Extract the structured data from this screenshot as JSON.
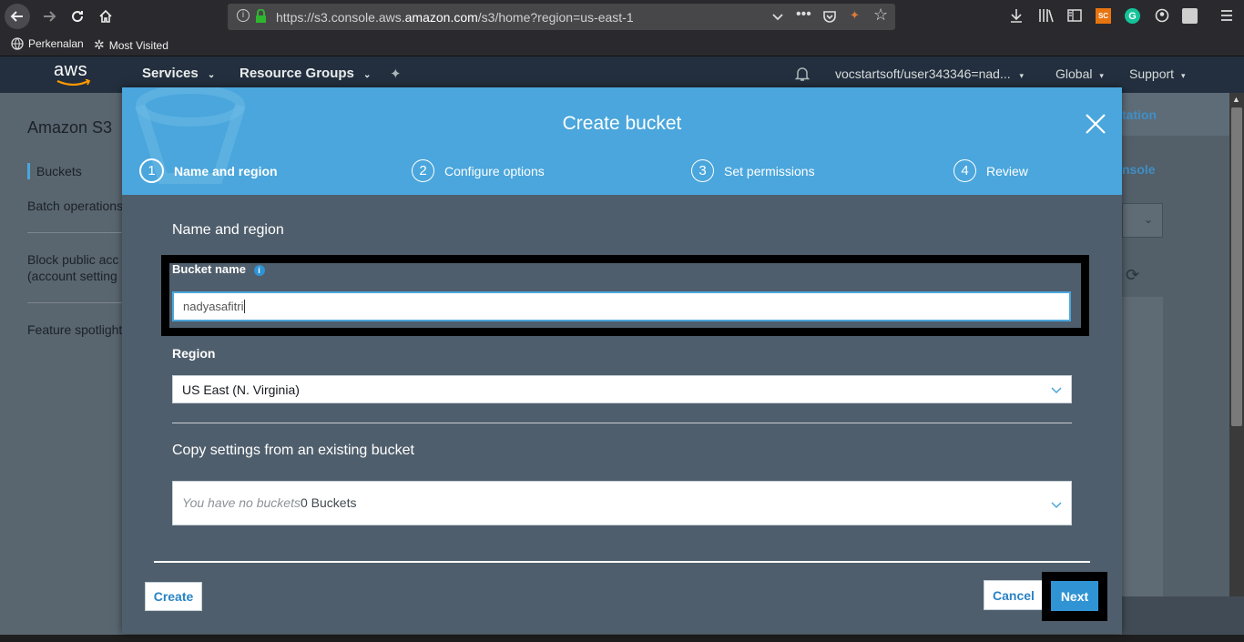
{
  "browser": {
    "url_prefix": "https://s3.console.aws.",
    "url_domain": "amazon.com",
    "url_suffix": "/s3/home?region=us-east-1",
    "bookmarks": [
      "Perkenalan",
      "Most Visited"
    ],
    "ext_sc_label": "SC",
    "ext_g_label": "G"
  },
  "aws_nav": {
    "logo": "aws",
    "services": "Services",
    "resource_groups": "Resource Groups",
    "account": "vocstartsoft/user343346=nad...",
    "region": "Global",
    "support": "Support"
  },
  "background_page": {
    "title": "Amazon S3",
    "nav": [
      "Buckets",
      "Batch operations",
      "Block public acc",
      "(account setting",
      "Feature spotlight"
    ],
    "right_link_1": "tation",
    "right_link_2": "nsole"
  },
  "modal": {
    "title": "Create bucket",
    "steps": [
      {
        "num": "1",
        "label": "Name and region"
      },
      {
        "num": "2",
        "label": "Configure options"
      },
      {
        "num": "3",
        "label": "Set permissions"
      },
      {
        "num": "4",
        "label": "Review"
      }
    ],
    "section_title": "Name and region",
    "bucket_name_label": "Bucket name",
    "bucket_name_value": "nadyasafitri",
    "region_label": "Region",
    "region_value": "US East (N. Virginia)",
    "copy_title": "Copy settings from an existing bucket",
    "copy_placeholder": "You have no buckets",
    "copy_count": "0 Buckets",
    "create_button": "Create",
    "cancel_button": "Cancel",
    "next_button": "Next"
  },
  "colors": {
    "modal_header": "#4aa6dc",
    "modal_body": "#4f5e6c",
    "aws_nav": "#232f3e",
    "primary_button": "#2f93d4"
  }
}
